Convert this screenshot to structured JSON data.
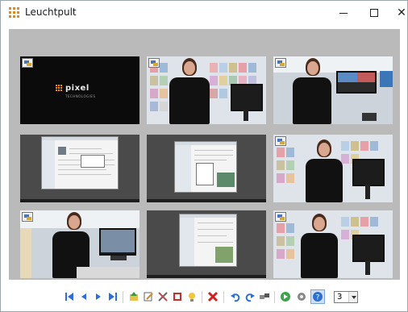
{
  "window": {
    "title": "Leuchtpult"
  },
  "thumbnails": [
    {
      "id": "thumb-1",
      "kind": "logo",
      "logo_text": "pixel",
      "logo_sub": "TECHNOLOGIES"
    },
    {
      "id": "thumb-2",
      "kind": "presenter"
    },
    {
      "id": "thumb-3",
      "kind": "presenter-office"
    },
    {
      "id": "thumb-4",
      "kind": "screenshot"
    },
    {
      "id": "thumb-5",
      "kind": "screenshot"
    },
    {
      "id": "thumb-6",
      "kind": "presenter"
    },
    {
      "id": "thumb-7",
      "kind": "presenter-office"
    },
    {
      "id": "thumb-8",
      "kind": "screenshot"
    },
    {
      "id": "thumb-9",
      "kind": "presenter"
    }
  ],
  "toolbar": {
    "buttons": [
      {
        "name": "first-icon"
      },
      {
        "name": "previous-icon"
      },
      {
        "name": "play-icon"
      },
      {
        "name": "last-icon"
      },
      {
        "name": "import-icon"
      },
      {
        "name": "edit-icon"
      },
      {
        "name": "tools-icon"
      },
      {
        "name": "filmstrip-icon"
      },
      {
        "name": "light-icon"
      },
      {
        "name": "delete-icon"
      },
      {
        "name": "undo-icon"
      },
      {
        "name": "redo-icon"
      },
      {
        "name": "transfer-icon"
      },
      {
        "name": "go-icon"
      },
      {
        "name": "gear-icon"
      },
      {
        "name": "help-icon"
      }
    ],
    "columns_select": {
      "value": "3"
    }
  },
  "colors": {
    "accent": "#e08a1e",
    "lighttable_bg": "#bababa",
    "delete_red": "#d21f1f",
    "nav_blue": "#2d6fd0"
  }
}
